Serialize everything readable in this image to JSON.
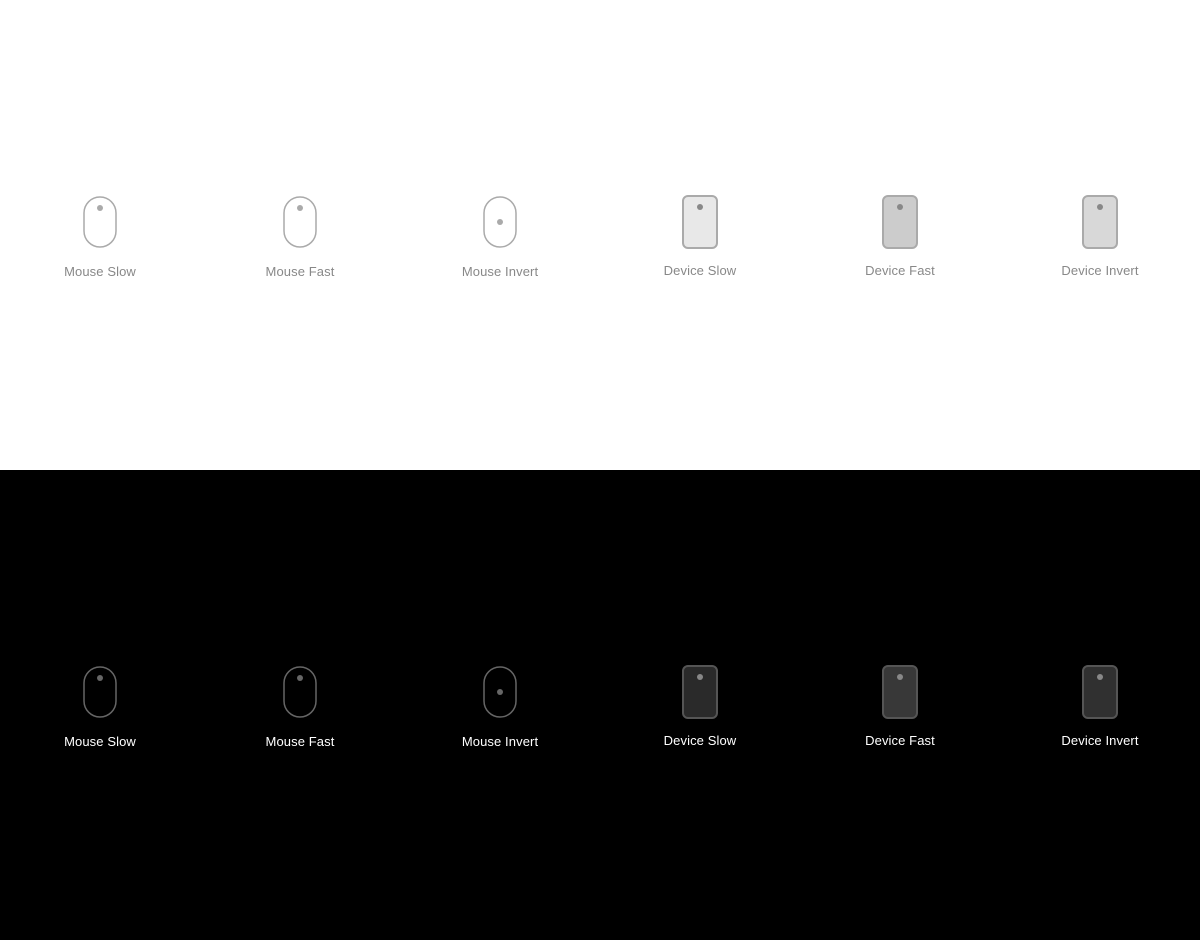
{
  "sections": [
    {
      "id": "light",
      "theme": "light",
      "bg": "#ffffff",
      "labelColor": "#888888",
      "icons": [
        {
          "type": "mouse",
          "variant": "slow",
          "label": "Mouse Slow"
        },
        {
          "type": "mouse",
          "variant": "fast",
          "label": "Mouse Fast"
        },
        {
          "type": "mouse",
          "variant": "invert",
          "label": "Mouse Invert"
        },
        {
          "type": "device",
          "variant": "slow",
          "label": "Device Slow"
        },
        {
          "type": "device",
          "variant": "fast",
          "label": "Device Fast"
        },
        {
          "type": "device",
          "variant": "invert",
          "label": "Device Invert"
        }
      ]
    },
    {
      "id": "dark",
      "theme": "dark",
      "bg": "#000000",
      "labelColor": "#ffffff",
      "icons": [
        {
          "type": "mouse",
          "variant": "slow",
          "label": "Mouse Slow"
        },
        {
          "type": "mouse",
          "variant": "fast",
          "label": "Mouse Fast"
        },
        {
          "type": "mouse",
          "variant": "invert",
          "label": "Mouse Invert"
        },
        {
          "type": "device",
          "variant": "slow",
          "label": "Device Slow"
        },
        {
          "type": "device",
          "variant": "fast",
          "label": "Device Fast"
        },
        {
          "type": "device",
          "variant": "invert",
          "label": "Device Invert"
        }
      ]
    }
  ]
}
